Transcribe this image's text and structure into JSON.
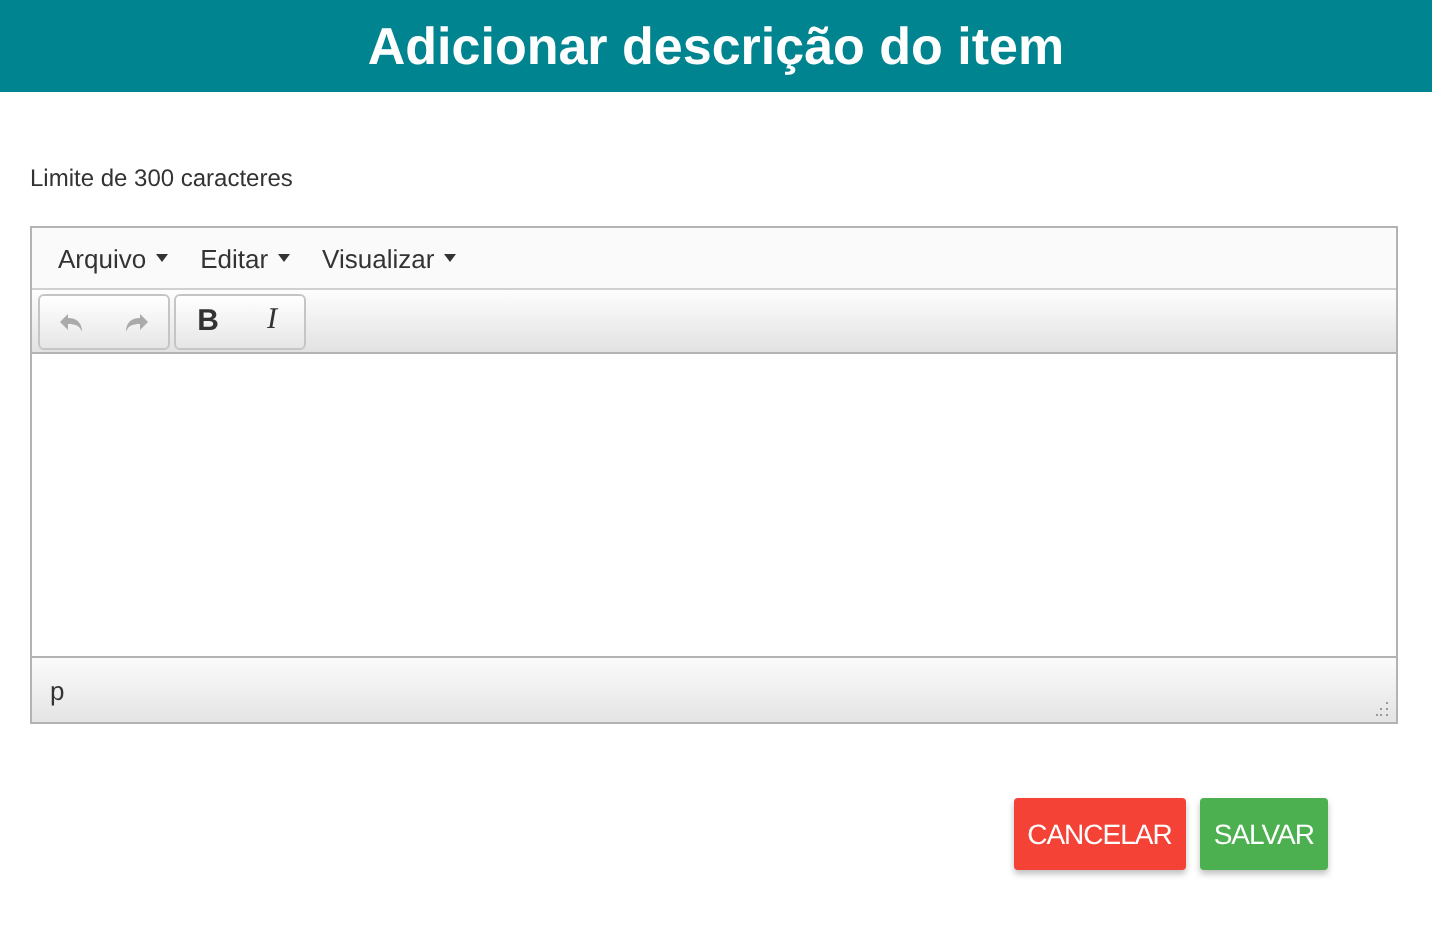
{
  "header": {
    "title": "Adicionar descrição do item"
  },
  "limit_label": "Limite de 300 caracteres",
  "editor": {
    "menus": [
      "Arquivo",
      "Editar",
      "Visualizar"
    ],
    "toolbar_groups": [
      [
        {
          "kind": "undo",
          "disabled": true
        },
        {
          "kind": "redo",
          "disabled": true
        }
      ],
      [
        {
          "kind": "bold",
          "label": "B",
          "disabled": false
        },
        {
          "kind": "italic",
          "label": "I",
          "disabled": false
        }
      ]
    ],
    "status_path": "p"
  },
  "buttons": [
    {
      "kind": "cancel",
      "label": "CANCELAR"
    },
    {
      "kind": "save",
      "label": "SALVAR"
    }
  ]
}
